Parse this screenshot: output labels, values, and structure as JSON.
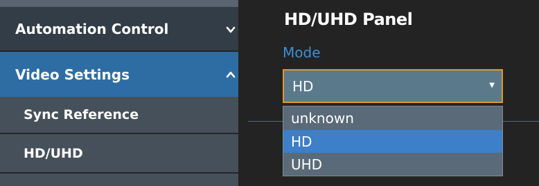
{
  "sidebar": {
    "items": [
      {
        "label": "Automation Control",
        "state": "collapsed"
      },
      {
        "label": "Video Settings",
        "state": "expanded"
      },
      {
        "label": "Sync Reference"
      },
      {
        "label": "HD/UHD"
      }
    ]
  },
  "panel": {
    "title": "HD/UHD Panel",
    "mode_label": "Mode",
    "mode_select": {
      "value": "HD",
      "options": [
        "unknown",
        "HD",
        "UHD"
      ],
      "highlighted": "HD"
    }
  },
  "colors": {
    "accent": "#3d8fd6",
    "active_nav": "#2e6da4",
    "focus_border": "#e8952b",
    "highlight": "#3d7fc8"
  },
  "icons": [
    "chevron-down-icon",
    "chevron-up-icon",
    "dropdown-arrow-icon"
  ]
}
